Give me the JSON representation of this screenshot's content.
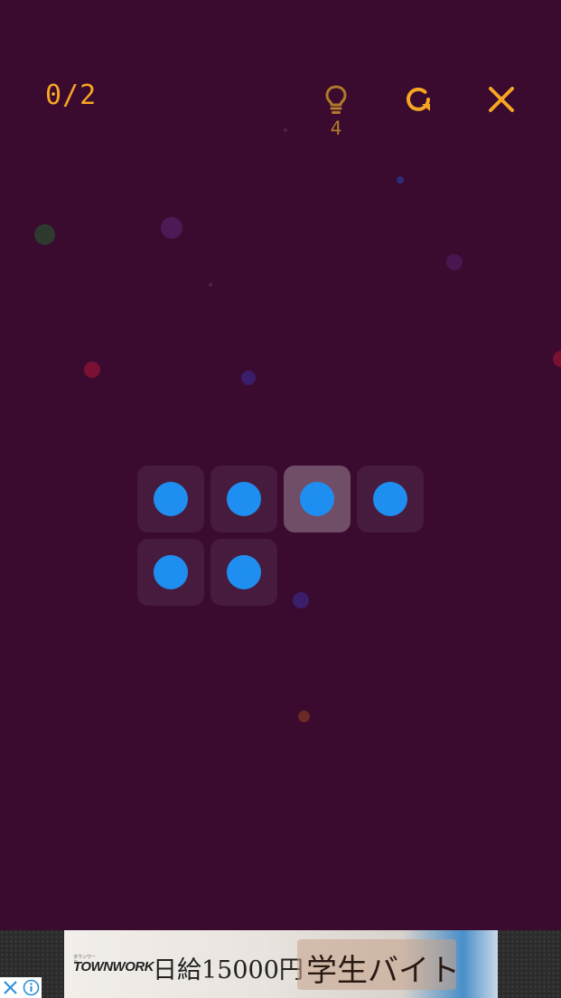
{
  "header": {
    "score": "0/2",
    "hints_remaining": "4"
  },
  "colors": {
    "background": "#3a0a2f",
    "accent": "#f5a623",
    "dot": "#1e8ff0"
  },
  "board": {
    "cells": [
      {
        "row": 0,
        "col": 0,
        "has_dot": true,
        "selected": false
      },
      {
        "row": 0,
        "col": 1,
        "has_dot": true,
        "selected": false
      },
      {
        "row": 0,
        "col": 2,
        "has_dot": true,
        "selected": true
      },
      {
        "row": 0,
        "col": 3,
        "has_dot": true,
        "selected": false
      },
      {
        "row": 1,
        "col": 0,
        "has_dot": true,
        "selected": false
      },
      {
        "row": 1,
        "col": 1,
        "has_dot": true,
        "selected": false
      }
    ]
  },
  "ad": {
    "brand_small": "タウンワーク",
    "brand": "TOWNWORK",
    "wage": "日給15000円",
    "tagline": "学生バイト"
  }
}
